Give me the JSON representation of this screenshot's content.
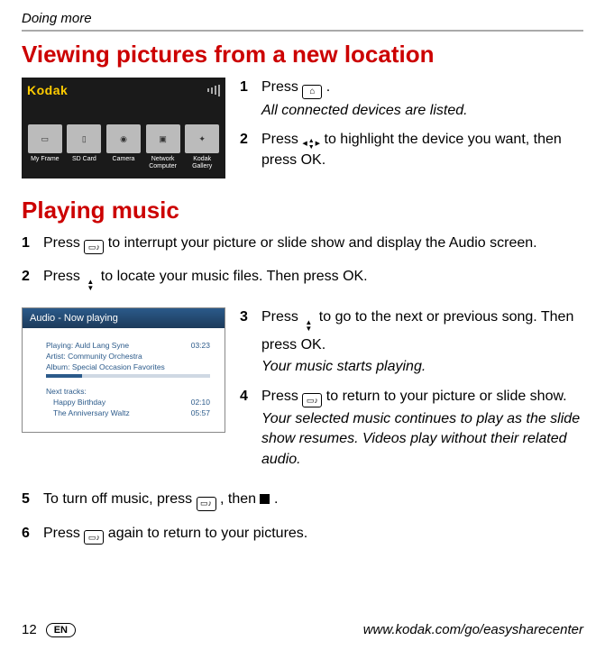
{
  "breadcrumb": "Doing more",
  "title_1": "Viewing pictures from a new location",
  "kodak": {
    "logo": "Kodak",
    "devices": [
      {
        "label": "My Frame"
      },
      {
        "label": "SD Card"
      },
      {
        "label": "Camera"
      },
      {
        "label": "Network Computer"
      },
      {
        "label": "Kodak Gallery"
      }
    ]
  },
  "section1_steps": [
    {
      "num": "1",
      "pre": "Press ",
      "post": " .",
      "italic": "All connected devices are listed."
    },
    {
      "num": "2",
      "pre": "Press ",
      "post": " to highlight the device you want, then press OK."
    }
  ],
  "title_2": "Playing music",
  "music_steps_top": [
    {
      "num": "1",
      "pre": "Press ",
      "post": " to interrupt your picture or slide show and display the Audio screen."
    },
    {
      "num": "2",
      "pre": "Press ",
      "post": " to locate your music files. Then press OK."
    }
  ],
  "audio": {
    "header": "Audio - Now playing",
    "playing_label": "Playing: Auld Lang Syne",
    "playing_time": "03:23",
    "artist": "Artist: Community Orchestra",
    "album": "Album: Special Occasion Favorites",
    "next_label": "Next tracks:",
    "next": [
      {
        "name": "Happy Birthday",
        "time": "02:10"
      },
      {
        "name": "The Anniversary Waltz",
        "time": "05:57"
      }
    ]
  },
  "music_steps_right": [
    {
      "num": "3",
      "pre": "Press ",
      "post": " to go to the next or previous song. Then press OK.",
      "italic": "Your music starts playing."
    },
    {
      "num": "4",
      "pre": "Press ",
      "post": " to return to your picture or slide show.",
      "italic": "Your selected music continues to play as the slide show resumes. Videos play without their related audio."
    }
  ],
  "music_steps_bottom": [
    {
      "num": "5",
      "pre": "To turn off music, press ",
      "mid": ", then ",
      "post": " ."
    },
    {
      "num": "6",
      "pre": "Press ",
      "post": " again to return to your pictures."
    }
  ],
  "footer": {
    "page": "12",
    "lang": "EN",
    "url": "www.kodak.com/go/easysharecenter"
  }
}
